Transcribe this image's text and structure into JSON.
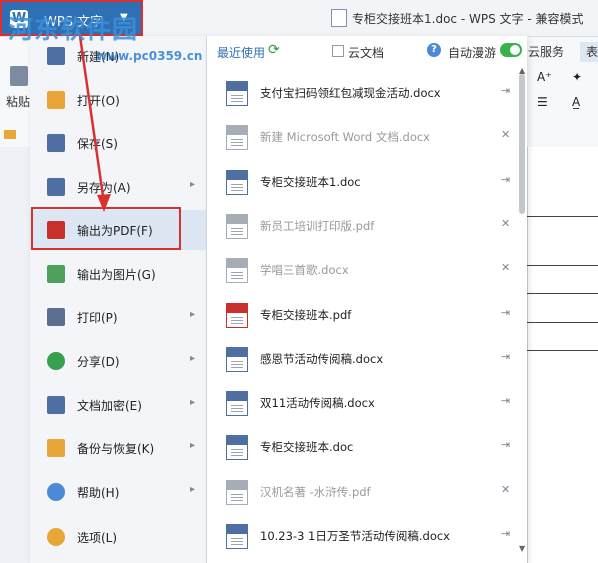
{
  "titlebar": {
    "app_button_label": "WPS 文字",
    "app_button_caret": "▼",
    "window_title": "专柜交接班本1.doc - WPS 文字 - 兼容模式"
  },
  "watermark": {
    "text": "河东软件园",
    "url": "www.pc0359.cn"
  },
  "ribbon": {
    "tabs": [
      "云服务",
      "表"
    ],
    "paste_label": "粘贴",
    "glyphs": [
      "A⁺",
      "✦",
      "☰",
      "A̲"
    ]
  },
  "menu": {
    "items": [
      {
        "label": "新建(N)",
        "icon": "new-doc-icon",
        "has_submenu": false
      },
      {
        "label": "打开(O)",
        "icon": "folder-open-icon",
        "has_submenu": false
      },
      {
        "label": "保存(S)",
        "icon": "save-icon",
        "has_submenu": false
      },
      {
        "label": "另存为(A)",
        "icon": "save-as-icon",
        "has_submenu": true
      },
      {
        "label": "输出为PDF(F)",
        "icon": "pdf-export-icon",
        "has_submenu": false
      },
      {
        "label": "输出为图片(G)",
        "icon": "image-export-icon",
        "has_submenu": false
      },
      {
        "label": "打印(P)",
        "icon": "printer-icon",
        "has_submenu": true
      },
      {
        "label": "分享(D)",
        "icon": "share-icon",
        "has_submenu": true
      },
      {
        "label": "文档加密(E)",
        "icon": "lock-icon",
        "has_submenu": true
      },
      {
        "label": "备份与恢复(K)",
        "icon": "backup-icon",
        "has_submenu": true
      },
      {
        "label": "帮助(H)",
        "icon": "help-icon",
        "has_submenu": true
      },
      {
        "label": "选项(L)",
        "icon": "gear-icon",
        "has_submenu": false
      }
    ],
    "submenu_arrow": "▸",
    "highlighted_index": 4
  },
  "recent": {
    "title": "最近使用",
    "cloud_label": "云文档",
    "roam_label": "自动漫游",
    "roam_enabled": true,
    "files": [
      {
        "name": "支付宝扫码领红包减现金活动.docx",
        "type": "doc",
        "dim": false,
        "action": "⇥"
      },
      {
        "name": "新建 Microsoft Word 文档.docx",
        "type": "doc-grey",
        "dim": true,
        "action": "✕"
      },
      {
        "name": "专柜交接班本1.doc",
        "type": "doc",
        "dim": false,
        "action": "⇥"
      },
      {
        "name": "新员工培训打印版.pdf",
        "type": "pdf-grey",
        "dim": true,
        "action": "✕"
      },
      {
        "name": "学唱三首歌.docx",
        "type": "doc-grey",
        "dim": true,
        "action": "✕"
      },
      {
        "name": "专柜交接班本.pdf",
        "type": "pdf",
        "dim": false,
        "action": "⇥"
      },
      {
        "name": "感恩节活动传阅稿.docx",
        "type": "doc",
        "dim": false,
        "action": "⇥"
      },
      {
        "name": "双11活动传阅稿.docx",
        "type": "doc",
        "dim": false,
        "action": "⇥"
      },
      {
        "name": "专柜交接班本.doc",
        "type": "doc",
        "dim": false,
        "action": "⇥"
      },
      {
        "name": "汉机名著 -水浒传.pdf",
        "type": "pdf-grey",
        "dim": true,
        "action": "✕"
      },
      {
        "name": "10.23-3 1日万圣节活动传阅稿.docx",
        "type": "doc",
        "dim": false,
        "action": "⇥"
      }
    ]
  },
  "colors": {
    "accent": "#2f6fb3",
    "highlight_box": "#d9312f",
    "toggle_on": "#37b24d"
  }
}
